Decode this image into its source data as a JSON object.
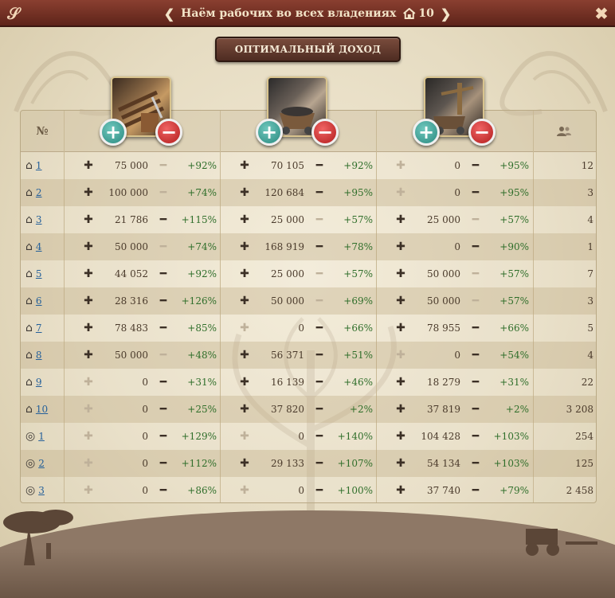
{
  "window": {
    "title": "Наём рабочих во всех владениях",
    "property_count": "10",
    "prev_icon": "chevron-left-icon",
    "next_icon": "chevron-right-icon",
    "menu_icon": "swirl-menu-icon",
    "close_icon": "close-icon"
  },
  "optimal_button": "ОПТИМАЛЬНЫЙ ДОХОД",
  "header": {
    "num_label": "№",
    "people_icon": "workers-icon",
    "resources": [
      {
        "name": "wood-resource-icon",
        "plus": "+",
        "minus": "−"
      },
      {
        "name": "stone-mine-resource-icon",
        "plus": "+",
        "minus": "−"
      },
      {
        "name": "ore-mine-resource-icon",
        "plus": "+",
        "minus": "−"
      }
    ]
  },
  "colors": {
    "title_bar": "#6e2e22",
    "percent_green": "#2f6e2a",
    "link_blue": "#25609a",
    "plus_teal": "#2a8a80",
    "minus_red": "#b21d1d"
  },
  "rows": [
    {
      "type": "house",
      "id": "1",
      "cols": [
        {
          "value": "75 000",
          "plus": true,
          "minus": false,
          "pct": "+92%"
        },
        {
          "value": "70 105",
          "plus": true,
          "minus": true,
          "pct": "+92%"
        },
        {
          "value": "0",
          "plus": false,
          "minus": true,
          "pct": "+95%"
        }
      ],
      "people": "12"
    },
    {
      "type": "house",
      "id": "2",
      "cols": [
        {
          "value": "100 000",
          "plus": true,
          "minus": false,
          "pct": "+74%"
        },
        {
          "value": "120 684",
          "plus": true,
          "minus": true,
          "pct": "+95%"
        },
        {
          "value": "0",
          "plus": false,
          "minus": true,
          "pct": "+95%"
        }
      ],
      "people": "3"
    },
    {
      "type": "house",
      "id": "3",
      "cols": [
        {
          "value": "21 786",
          "plus": true,
          "minus": true,
          "pct": "+115%"
        },
        {
          "value": "25 000",
          "plus": true,
          "minus": false,
          "pct": "+57%"
        },
        {
          "value": "25 000",
          "plus": true,
          "minus": false,
          "pct": "+57%"
        }
      ],
      "people": "4"
    },
    {
      "type": "house",
      "id": "4",
      "cols": [
        {
          "value": "50 000",
          "plus": true,
          "minus": false,
          "pct": "+74%"
        },
        {
          "value": "168 919",
          "plus": true,
          "minus": true,
          "pct": "+78%"
        },
        {
          "value": "0",
          "plus": true,
          "minus": true,
          "pct": "+90%"
        }
      ],
      "people": "1"
    },
    {
      "type": "house",
      "id": "5",
      "cols": [
        {
          "value": "44 052",
          "plus": true,
          "minus": true,
          "pct": "+92%"
        },
        {
          "value": "25 000",
          "plus": true,
          "minus": false,
          "pct": "+57%"
        },
        {
          "value": "50 000",
          "plus": true,
          "minus": false,
          "pct": "+57%"
        }
      ],
      "people": "7"
    },
    {
      "type": "house",
      "id": "6",
      "cols": [
        {
          "value": "28 316",
          "plus": true,
          "minus": true,
          "pct": "+126%"
        },
        {
          "value": "50 000",
          "plus": true,
          "minus": false,
          "pct": "+69%"
        },
        {
          "value": "50 000",
          "plus": true,
          "minus": false,
          "pct": "+57%"
        }
      ],
      "people": "3"
    },
    {
      "type": "house",
      "id": "7",
      "cols": [
        {
          "value": "78 483",
          "plus": true,
          "minus": true,
          "pct": "+85%"
        },
        {
          "value": "0",
          "plus": false,
          "minus": true,
          "pct": "+66%"
        },
        {
          "value": "78 955",
          "plus": true,
          "minus": true,
          "pct": "+66%"
        }
      ],
      "people": "5"
    },
    {
      "type": "house",
      "id": "8",
      "cols": [
        {
          "value": "50 000",
          "plus": true,
          "minus": false,
          "pct": "+48%"
        },
        {
          "value": "56 371",
          "plus": true,
          "minus": true,
          "pct": "+51%"
        },
        {
          "value": "0",
          "plus": false,
          "minus": true,
          "pct": "+54%"
        }
      ],
      "people": "4"
    },
    {
      "type": "house",
      "id": "9",
      "cols": [
        {
          "value": "0",
          "plus": false,
          "minus": true,
          "pct": "+31%"
        },
        {
          "value": "16 139",
          "plus": true,
          "minus": true,
          "pct": "+46%"
        },
        {
          "value": "18 279",
          "plus": true,
          "minus": true,
          "pct": "+31%"
        }
      ],
      "people": "22"
    },
    {
      "type": "house",
      "id": "10",
      "cols": [
        {
          "value": "0",
          "plus": false,
          "minus": true,
          "pct": "+25%"
        },
        {
          "value": "37 820",
          "plus": true,
          "minus": true,
          "pct": "+2%"
        },
        {
          "value": "37 819",
          "plus": true,
          "minus": true,
          "pct": "+2%"
        }
      ],
      "people": "3 208"
    },
    {
      "type": "globe",
      "id": "1",
      "cols": [
        {
          "value": "0",
          "plus": false,
          "minus": true,
          "pct": "+129%"
        },
        {
          "value": "0",
          "plus": false,
          "minus": true,
          "pct": "+140%"
        },
        {
          "value": "104 428",
          "plus": true,
          "minus": true,
          "pct": "+103%"
        }
      ],
      "people": "254"
    },
    {
      "type": "globe",
      "id": "2",
      "cols": [
        {
          "value": "0",
          "plus": false,
          "minus": true,
          "pct": "+112%"
        },
        {
          "value": "29 133",
          "plus": true,
          "minus": true,
          "pct": "+107%"
        },
        {
          "value": "54 134",
          "plus": true,
          "minus": true,
          "pct": "+103%"
        }
      ],
      "people": "125"
    },
    {
      "type": "globe",
      "id": "3",
      "cols": [
        {
          "value": "0",
          "plus": false,
          "minus": true,
          "pct": "+86%"
        },
        {
          "value": "0",
          "plus": false,
          "minus": true,
          "pct": "+100%"
        },
        {
          "value": "37 740",
          "plus": true,
          "minus": true,
          "pct": "+79%"
        }
      ],
      "people": "2 458"
    }
  ]
}
